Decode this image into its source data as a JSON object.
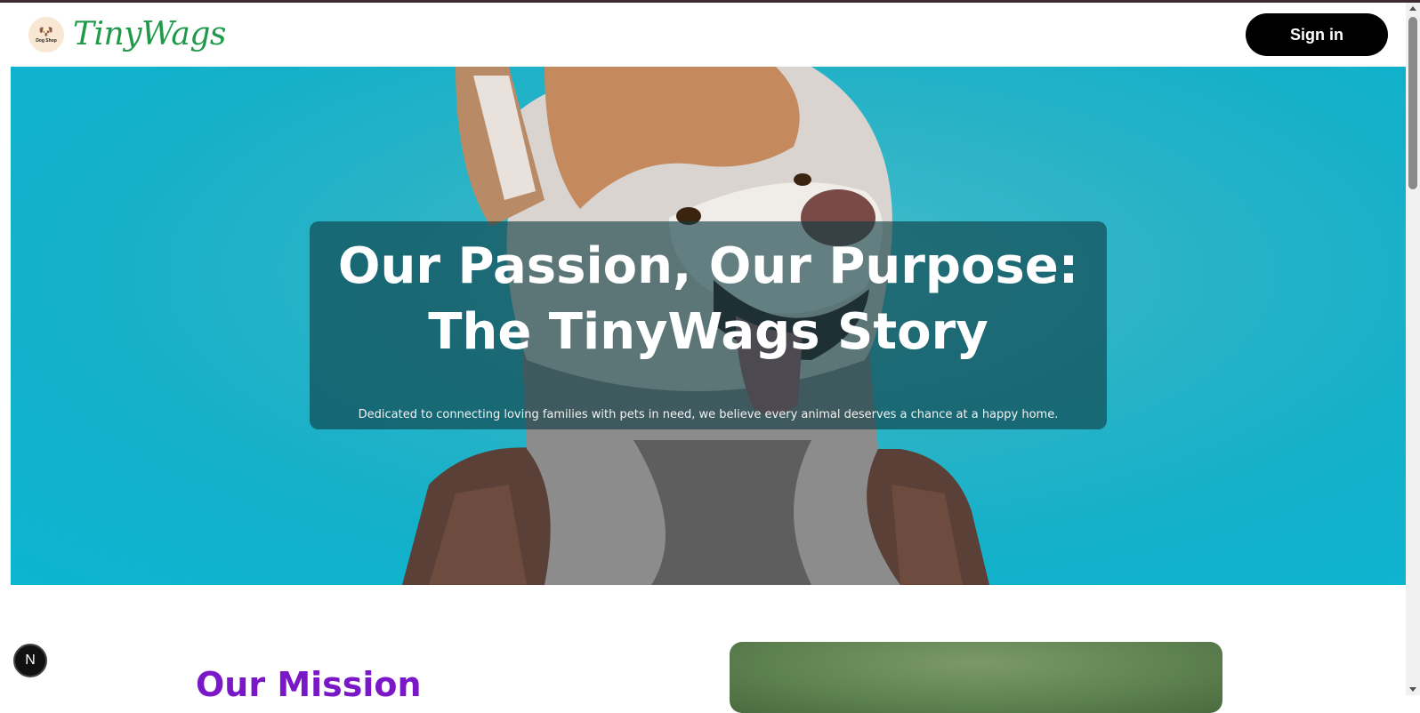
{
  "header": {
    "logo_text": "Dog Shop",
    "brand": "TinyWags",
    "signin_label": "Sign in"
  },
  "hero": {
    "title_line1": "Our Passion, Our Purpose:",
    "title_line2": "The TinyWags Story",
    "subtitle": "Dedicated to connecting loving families with pets in need, we believe every animal deserves a chance at a happy home.",
    "image_subject": "husky dog wearing houndstooth scarf on teal background"
  },
  "mission": {
    "title": "Our Mission"
  },
  "dev_badge": {
    "label": "N"
  },
  "colors": {
    "brand_green": "#1e9a4a",
    "hero_teal": "#14b0c9",
    "mission_purple": "#7a18c8",
    "button_black": "#000000"
  },
  "icons": [
    "dog-logo-icon",
    "scroll-up-icon",
    "scroll-down-icon"
  ]
}
